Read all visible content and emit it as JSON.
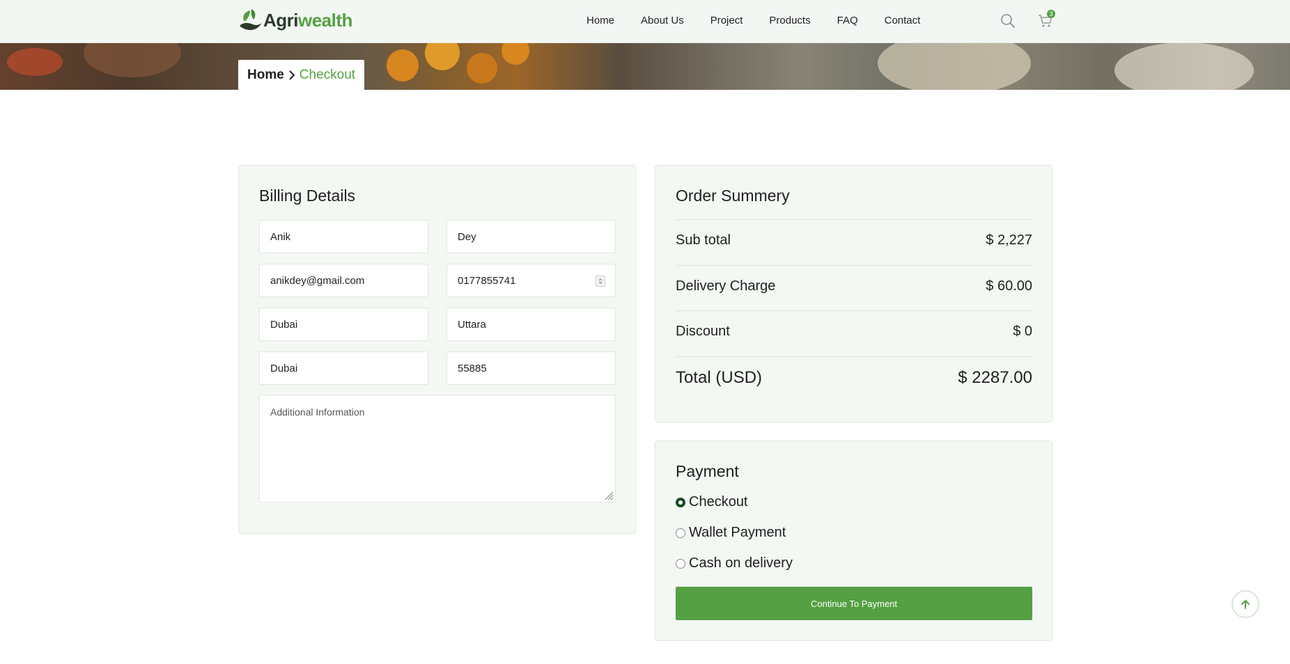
{
  "brand": {
    "name_part1": "Agri",
    "name_part2": "wealth",
    "accent": "#55a043"
  },
  "nav": {
    "items": [
      "Home",
      "About Us",
      "Project",
      "Products",
      "FAQ",
      "Contact"
    ]
  },
  "header": {
    "search_icon": "search-icon",
    "cart_icon": "cart-icon",
    "cart_count": "3"
  },
  "breadcrumb": {
    "home": "Home",
    "current": "Checkout"
  },
  "billing": {
    "title": "Billing Details",
    "first_name": "Anik",
    "last_name": "Dey",
    "email": "anikdey@gmail.com",
    "phone": "0177855741",
    "city": "Dubai",
    "area": "Uttara",
    "state": "Dubai",
    "zip": "55885",
    "additional_placeholder": "Additional Information"
  },
  "summary": {
    "title": "Order Summery",
    "rows": [
      {
        "label": "Sub total",
        "value": "$ 2,227"
      },
      {
        "label": "Delivery Charge",
        "value": "$ 60.00"
      },
      {
        "label": "Discount",
        "value": "$ 0"
      }
    ],
    "total_label": "Total (USD)",
    "total_value": "$ 2287.00"
  },
  "payment": {
    "title": "Payment",
    "options": [
      "Checkout",
      "Wallet Payment",
      "Cash on delivery"
    ],
    "selected": "Checkout",
    "button_label": "Continue To Payment"
  }
}
